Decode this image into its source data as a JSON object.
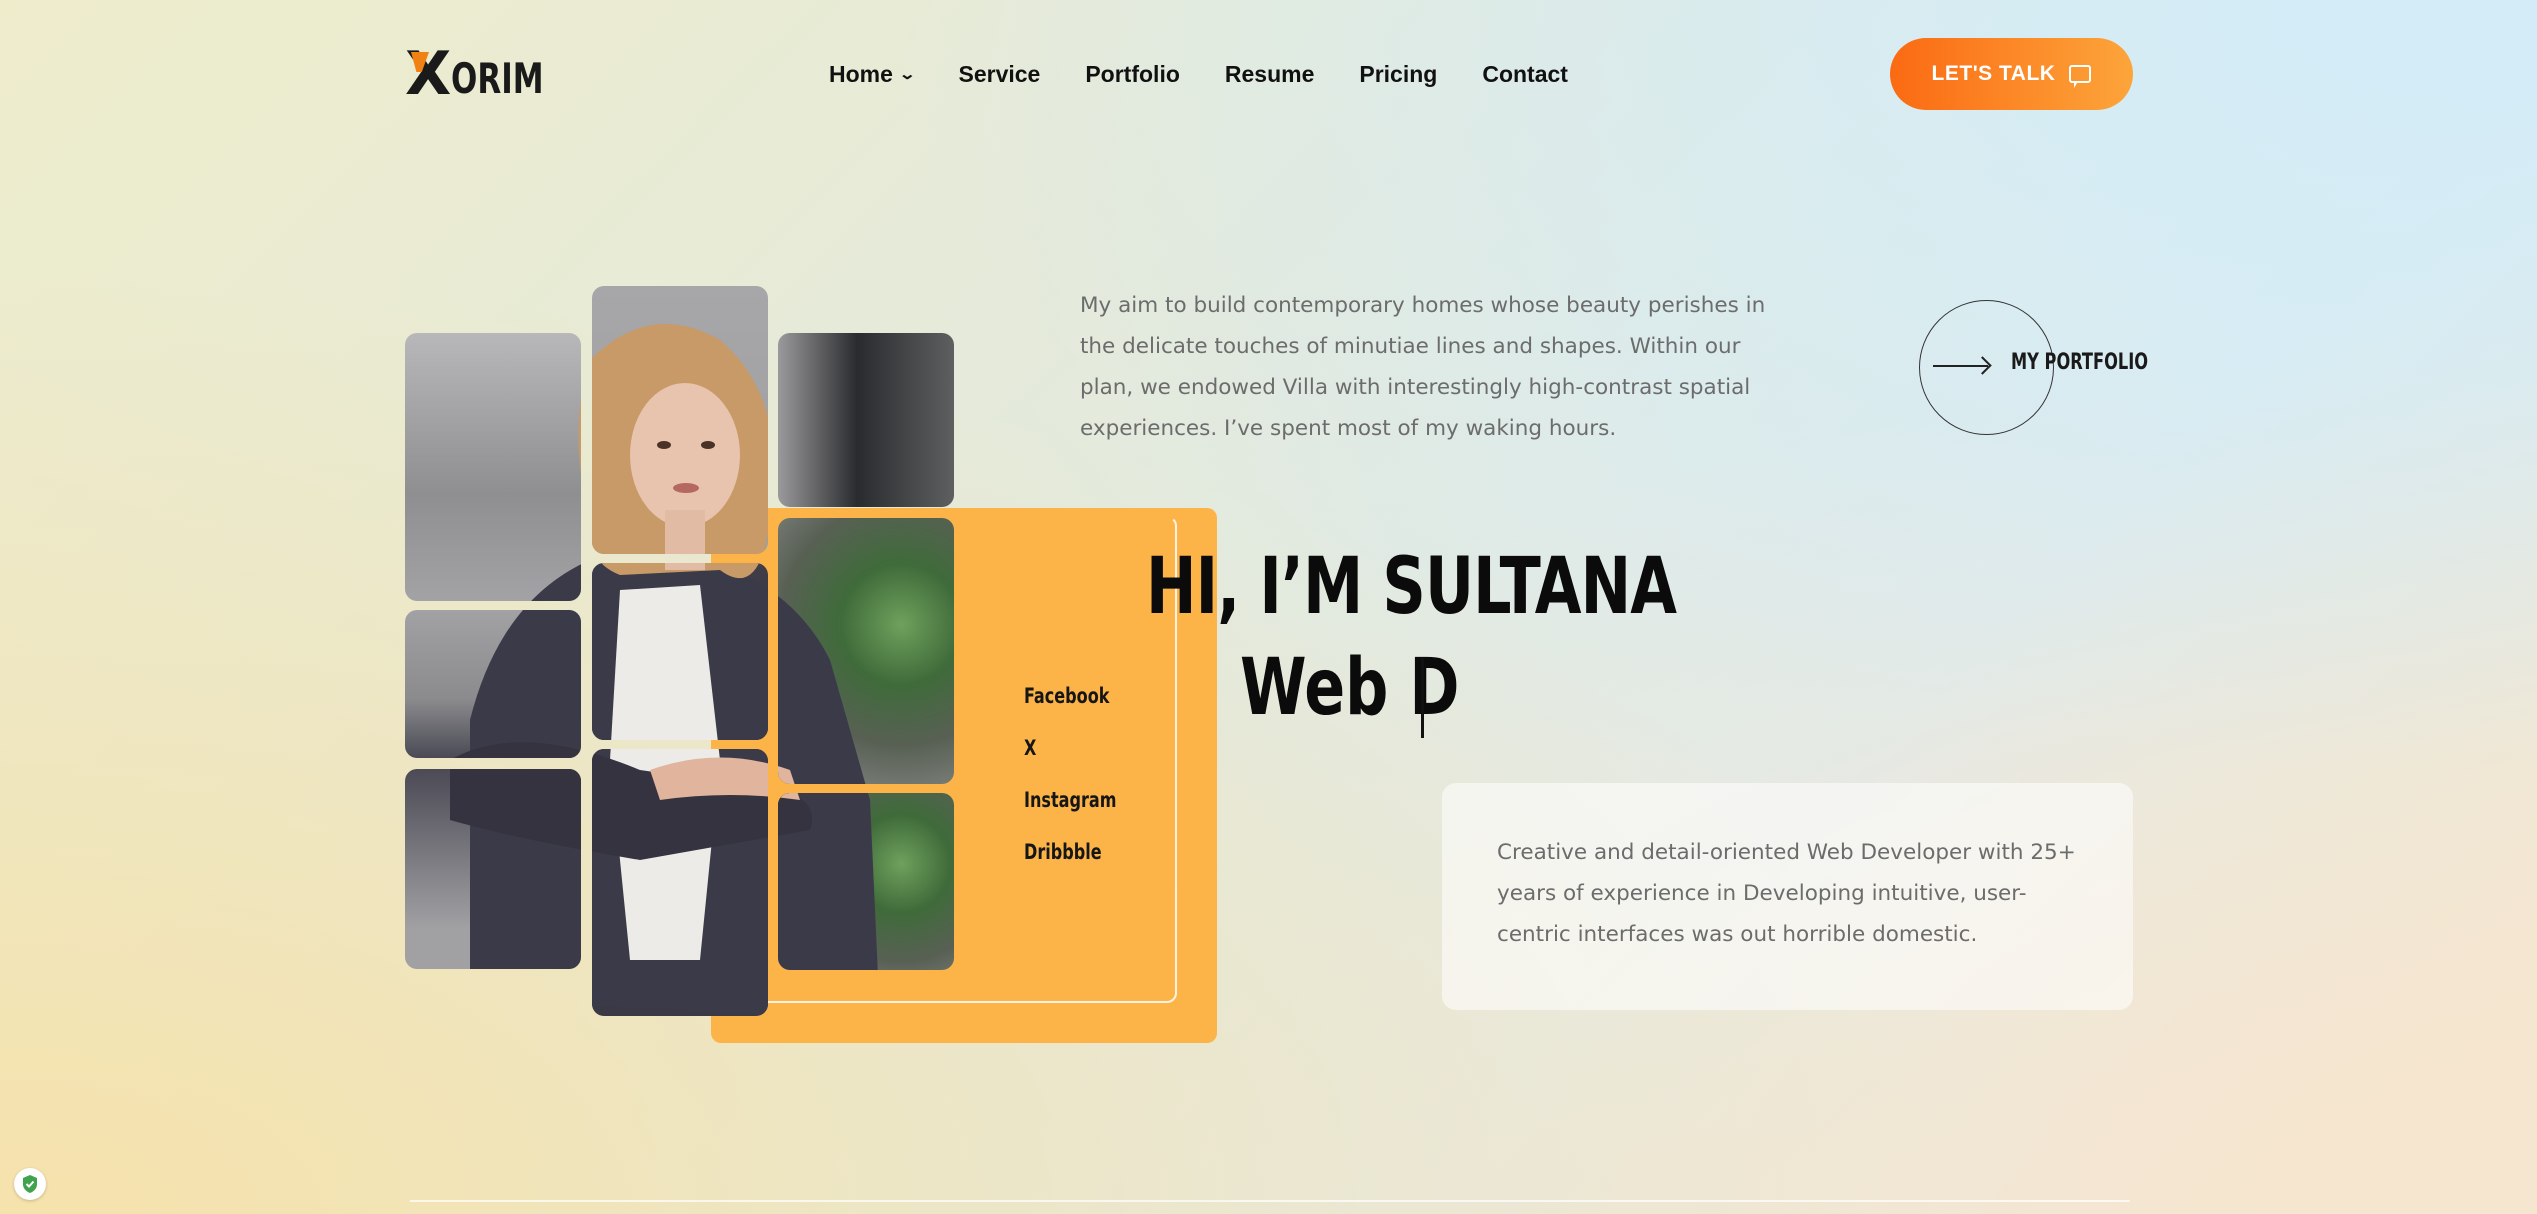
{
  "header": {
    "logo": {
      "letter": "X",
      "rest": "ORIM"
    },
    "nav": [
      {
        "label": "Home",
        "has_dropdown": true
      },
      {
        "label": "Service"
      },
      {
        "label": "Portfolio"
      },
      {
        "label": "Resume"
      },
      {
        "label": "Pricing"
      },
      {
        "label": "Contact"
      }
    ],
    "cta_label": "LET'S TALK",
    "cta_icon": "chat-icon"
  },
  "hero": {
    "about": "My aim to build contemporary homes whose beauty perishes in the delicate touches of minutiae lines and shapes. Within our plan, we endowed Villa with interestingly high-contrast spatial experiences. I’ve spent most of my waking hours.",
    "portfolio_label": "MY PORTFOLIO",
    "title": "HI, I’M SULTANA",
    "typed_text": "Web D",
    "description": "Creative and detail-oriented Web Developer with 25+ years of experience in Developing intuitive, user-centric interfaces was out horrible domestic.",
    "social": [
      "Facebook",
      "X",
      "Instagram",
      "Dribbble"
    ]
  },
  "colors": {
    "accent_orange": "#fb6a12",
    "card_orange": "#fcb449",
    "text_dark": "#0b0b0b",
    "text_muted": "#6c6c6c"
  }
}
